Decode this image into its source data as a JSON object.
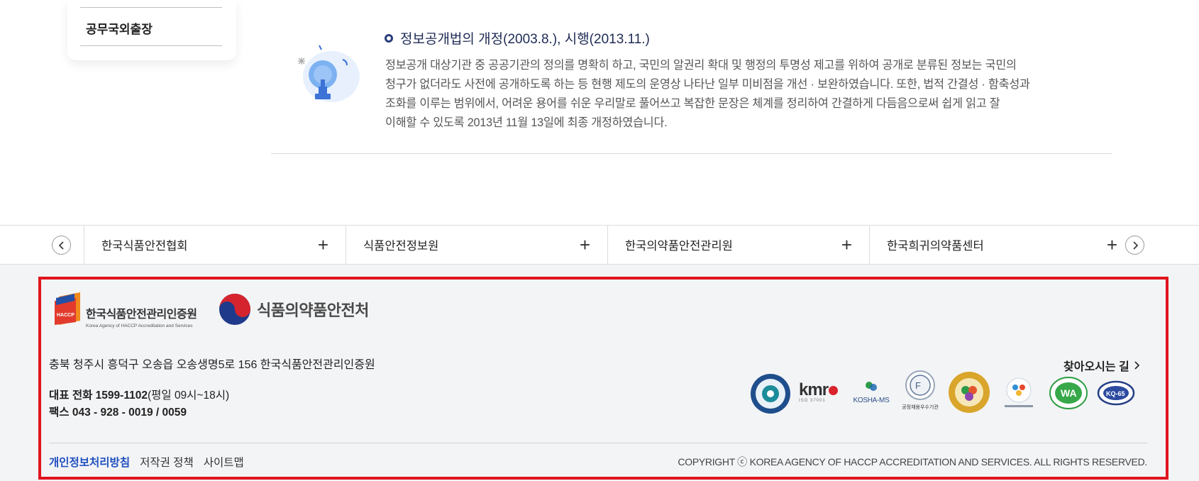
{
  "side_menu": {
    "item": "공무국외출장"
  },
  "law": {
    "title": "정보공개법의 개정(2003.8.), 시행(2013.11.)",
    "lines": [
      "정보공개 대상기관 중 공공기관의 정의를 명확히 하고, 국민의 알권리 확대 및 행정의 투명성 제고를 위하여 공개로 분류된 정보는 국민의",
      "청구가 없더라도 사전에 공개하도록 하는 등 현행 제도의 운영상 나타난 일부 미비점을 개선 · 보완하였습니다. 또한, 법적 간결성 · 함축성과",
      "조화를 이루는 범위에서, 어려운 용어를 쉬운 우리말로 풀어쓰고 복잡한 문장은 체계를 정리하여 간결하게 다듬음으로써 쉽게 읽고 잘",
      "이해할 수 있도록 2013년 11월 13일에 최종 개정하였습니다."
    ]
  },
  "related_sites": [
    {
      "label": "한국식품안전협회"
    },
    {
      "label": "식품안전정보원"
    },
    {
      "label": "한국의약품안전관리원"
    },
    {
      "label": "한국희귀의약품센터"
    }
  ],
  "footer": {
    "haccp_logo": {
      "badge": "HACCP",
      "name": "한국식품안전관리인증원",
      "sub": "Korea Agency of HACCP Accreditation and Services"
    },
    "mfds_logo": {
      "name": "식품의약품안전처"
    },
    "address": "충북 청주시 흥덕구 오송읍 오송생명5로 156 한국식품안전관리인증원",
    "phone_label": "대표 전화",
    "phone_number": "1599-1102",
    "phone_hours": "(평일 09시~18시)",
    "fax_label": "팩스",
    "fax_number": "043 - 928 - 0019 / 0059",
    "directions": "찾아오시는 길",
    "certifications": [
      {
        "name": "인적자원개발 우수기관"
      },
      {
        "name": "KMR ISO 37001"
      },
      {
        "name": "KOSHA-MS"
      },
      {
        "name": "공정채용우수기관"
      },
      {
        "name": "가족친화인증"
      },
      {
        "name": "교육기부 진로체험 인증기관"
      },
      {
        "name": "WA 웹접근성"
      },
      {
        "name": "KQ-65"
      }
    ],
    "cert_labels": {
      "kmr": "kmr",
      "kmr_sub": "ISO 37001",
      "kosha": "KOSHA-MS",
      "fair": "공정채용우수기관",
      "wa": "WA",
      "kq": "KQ-65"
    },
    "links": {
      "privacy": "개인정보처리방침",
      "copyright_policy": "저작권 정책",
      "sitemap": "사이트맵"
    },
    "copyright": "COPYRIGHT ⓒ KOREA AGENCY OF HACCP ACCREDITATION AND SERVICES. ALL RIGHTS RESERVED."
  },
  "colors": {
    "accent_navy": "#2a3e7a",
    "privacy_link": "#1f4fbf",
    "focus_frame": "#e0141e",
    "footer_bg": "#f3f4f6"
  }
}
